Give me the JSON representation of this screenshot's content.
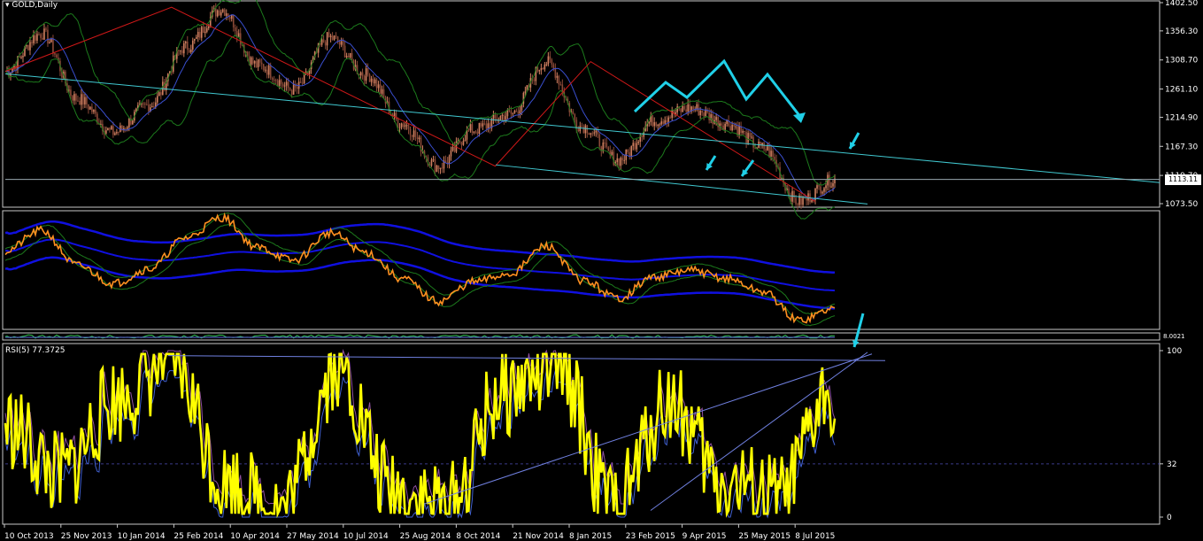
{
  "window": {
    "symbol_title": "GOLD,Daily",
    "menu_icon": "triangle-down-icon"
  },
  "colors": {
    "background": "#000000",
    "candle_up": "#d08060",
    "candle_down": "#8b4a38",
    "bollinger": "#1c7a1c",
    "moving_average": "#3a4fd0",
    "zigzag": "#d01818",
    "trendline": "#40c8d0",
    "arrows": "#20d0e8",
    "oscillator_line": "#ff9020",
    "band_blue": "#1010e0",
    "rsi_line": "#ffff00",
    "grid_level": "#3a3a8a"
  },
  "price_panel": {
    "y_ticks": [
      "1402.50",
      "1356.30",
      "1308.70",
      "1261.10",
      "1214.90",
      "1167.30",
      "1119.70",
      "1073.50"
    ],
    "current_price": "1113.11"
  },
  "indicator_strip": {
    "right_value": "8.0021"
  },
  "rsi_panel": {
    "label": "RSI(5) 77.3725",
    "y_ticks": [
      "100",
      "32",
      "0"
    ]
  },
  "x_axis": {
    "labels": [
      "10 Oct 2013",
      "25 Nov 2013",
      "10 Jan 2014",
      "25 Feb 2014",
      "10 Apr 2014",
      "27 May 2014",
      "10 Jul 2014",
      "25 Aug 2014",
      "8 Oct 2014",
      "21 Nov 2014",
      "8 Jan 2015",
      "23 Feb 2015",
      "9 Apr 2015",
      "25 May 2015",
      "8 Jul 2015"
    ]
  },
  "chart_data": {
    "type": "candlestick",
    "instrument": "GOLD",
    "timeframe": "Daily",
    "price_key_points": [
      {
        "date": "10 Oct 2013",
        "price": 1290
      },
      {
        "date": "25 Oct 2013",
        "price": 1352
      },
      {
        "date": "25 Nov 2013",
        "price": 1245
      },
      {
        "date": "31 Dec 2013",
        "price": 1190
      },
      {
        "date": "10 Jan 2014",
        "price": 1235
      },
      {
        "date": "25 Feb 2014",
        "price": 1330
      },
      {
        "date": "17 Mar 2014",
        "price": 1392
      },
      {
        "date": "10 Apr 2014",
        "price": 1300
      },
      {
        "date": "27 May 2014",
        "price": 1260
      },
      {
        "date": "10 Jul 2014",
        "price": 1345
      },
      {
        "date": "25 Aug 2014",
        "price": 1285
      },
      {
        "date": "8 Oct 2014",
        "price": 1205
      },
      {
        "date": "5 Nov 2014",
        "price": 1135
      },
      {
        "date": "21 Nov 2014",
        "price": 1195
      },
      {
        "date": "8 Jan 2015",
        "price": 1220
      },
      {
        "date": "22 Jan 2015",
        "price": 1305
      },
      {
        "date": "23 Feb 2015",
        "price": 1200
      },
      {
        "date": "17 Mar 2015",
        "price": 1145
      },
      {
        "date": "9 Apr 2015",
        "price": 1210
      },
      {
        "date": "18 May 2015",
        "price": 1230
      },
      {
        "date": "25 May 2015",
        "price": 1205
      },
      {
        "date": "8 Jul 2015",
        "price": 1165
      },
      {
        "date": "24 Jul 2015",
        "price": 1077
      },
      {
        "date": "7 Aug 2015",
        "price": 1113
      }
    ],
    "rsi_key_points": [
      {
        "date": "10 Oct 2013",
        "value": 55
      },
      {
        "date": "25 Nov 2013",
        "value": 25
      },
      {
        "date": "10 Jan 2014",
        "value": 70
      },
      {
        "date": "25 Feb 2014",
        "value": 95
      },
      {
        "date": "10 Apr 2014",
        "value": 20
      },
      {
        "date": "27 May 2014",
        "value": 5
      },
      {
        "date": "10 Jul 2014",
        "value": 90
      },
      {
        "date": "25 Aug 2014",
        "value": 15
      },
      {
        "date": "8 Oct 2014",
        "value": 5
      },
      {
        "date": "21 Nov 2014",
        "value": 75
      },
      {
        "date": "8 Jan 2015",
        "value": 92
      },
      {
        "date": "23 Feb 2015",
        "value": 5
      },
      {
        "date": "9 Apr 2015",
        "value": 70
      },
      {
        "date": "25 May 2015",
        "value": 20
      },
      {
        "date": "8 Jul 2015",
        "value": 10
      },
      {
        "date": "7 Aug 2015",
        "value": 77.3725
      }
    ],
    "rsi_levels": [
      100,
      32,
      0
    ],
    "ylim_price": [
      1073.5,
      1402.5
    ]
  }
}
